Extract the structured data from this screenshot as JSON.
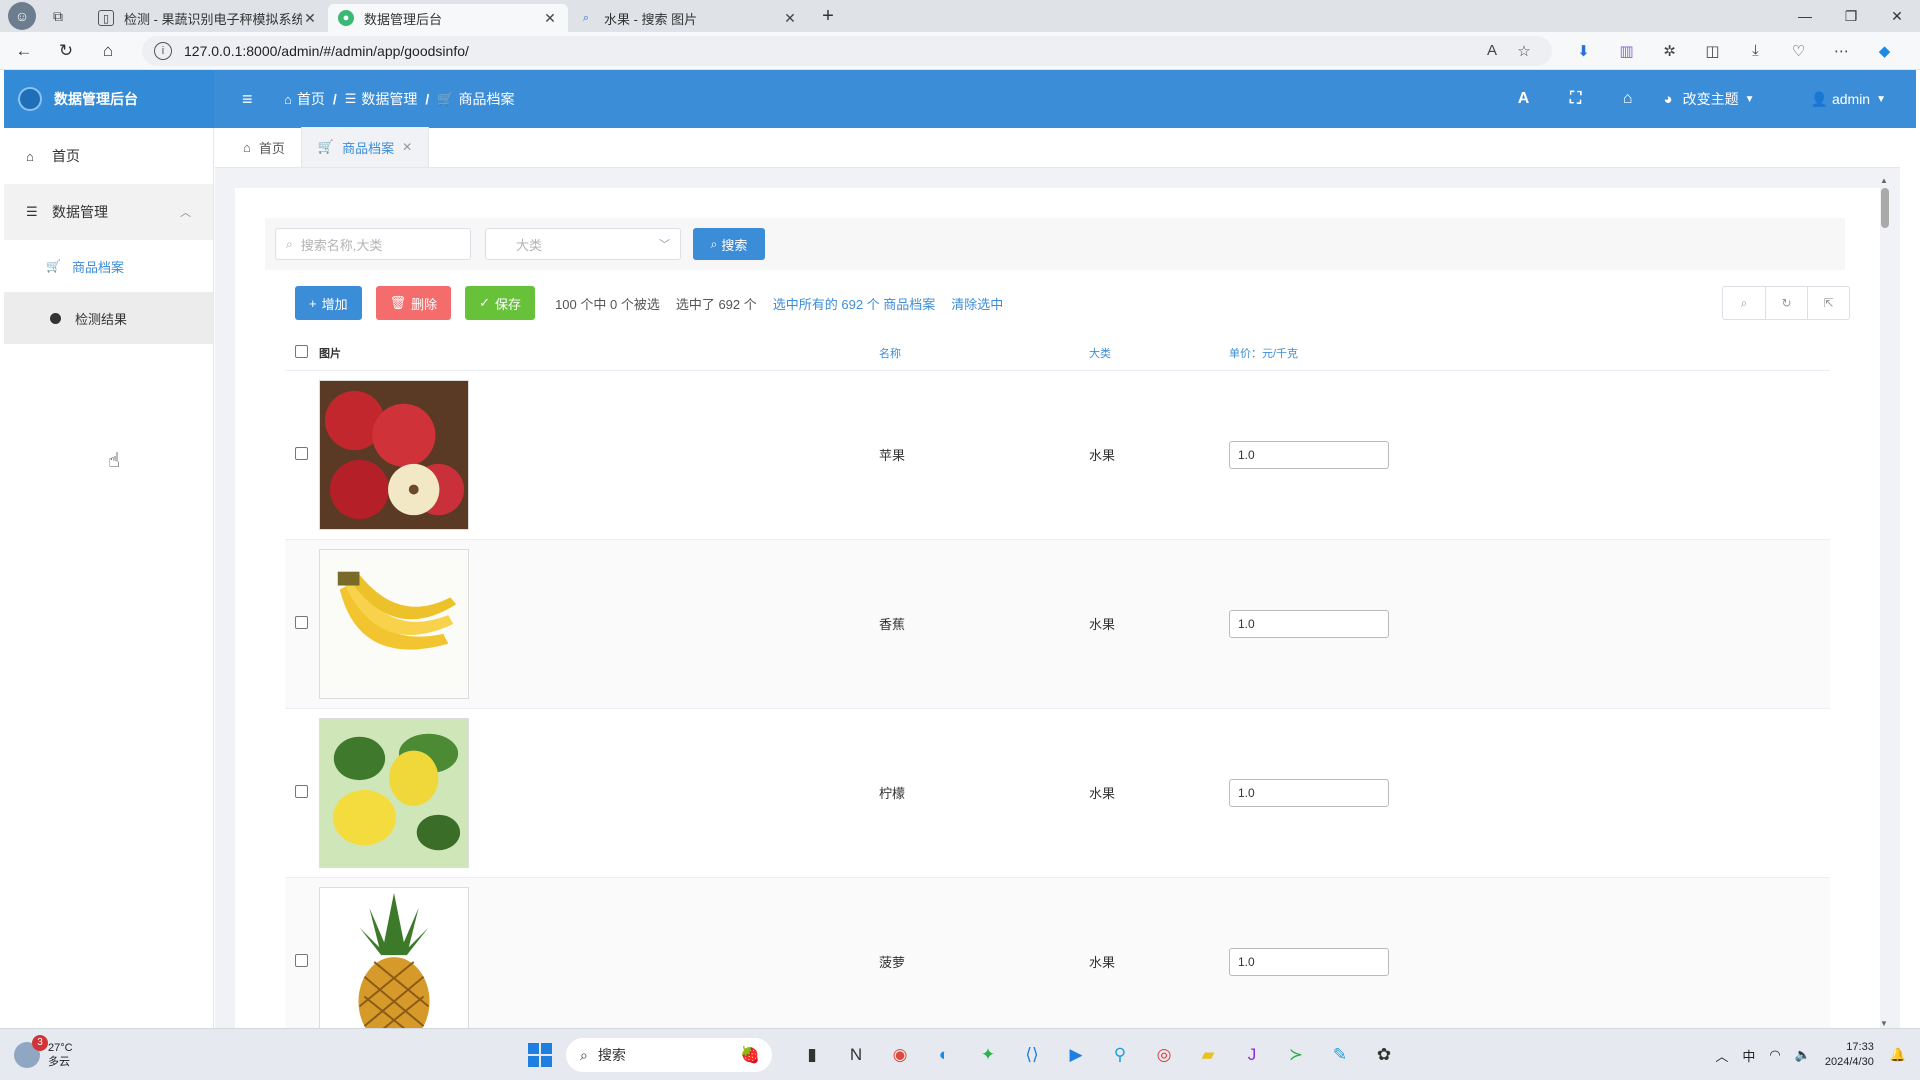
{
  "browser": {
    "tabs": [
      {
        "title": "检测 - 果蔬识别电子秤模拟系统",
        "active": false
      },
      {
        "title": "数据管理后台",
        "active": true
      },
      {
        "title": "水果 - 搜索 图片",
        "active": false
      }
    ],
    "url": "127.0.0.1:8000/admin/#/admin/app/goodsinfo/"
  },
  "header": {
    "brand": "数据管理后台",
    "breadcrumbs": [
      "首页",
      "数据管理",
      "商品档案"
    ],
    "theme_label": "改变主题",
    "user": "admin"
  },
  "sidebar": {
    "home": "首页",
    "group": "数据管理",
    "items": [
      "商品档案",
      "检测结果"
    ]
  },
  "content_tabs": [
    "首页",
    "商品档案"
  ],
  "search": {
    "placeholder": "搜索名称,大类",
    "select_placeholder": "大类",
    "button": "搜索"
  },
  "actions": {
    "add": "增加",
    "delete": "删除",
    "save": "保存",
    "selection_text": "100 个中 0 个被选",
    "selected_text": "选中了 692 个",
    "select_all_link": "选中所有的 692 个 商品档案",
    "clear_link": "清除选中"
  },
  "table": {
    "headers": {
      "image": "图片",
      "name": "名称",
      "category": "大类",
      "price": "单价：元/千克"
    },
    "rows": [
      {
        "name": "苹果",
        "category": "水果",
        "price": "1.0",
        "image": "apple"
      },
      {
        "name": "香蕉",
        "category": "水果",
        "price": "1.0",
        "image": "banana"
      },
      {
        "name": "柠檬",
        "category": "水果",
        "price": "1.0",
        "image": "lemon"
      },
      {
        "name": "菠萝",
        "category": "水果",
        "price": "1.0",
        "image": "pineapple"
      }
    ]
  },
  "taskbar": {
    "weather_temp": "27°C",
    "weather_desc": "多云",
    "weather_badge": "3",
    "search_label": "搜索",
    "ime": "中",
    "time": "17:33",
    "date": "2024/4/30"
  },
  "colors": {
    "primary": "#3c8dd8",
    "danger": "#f56c6c",
    "success": "#67c23a"
  }
}
